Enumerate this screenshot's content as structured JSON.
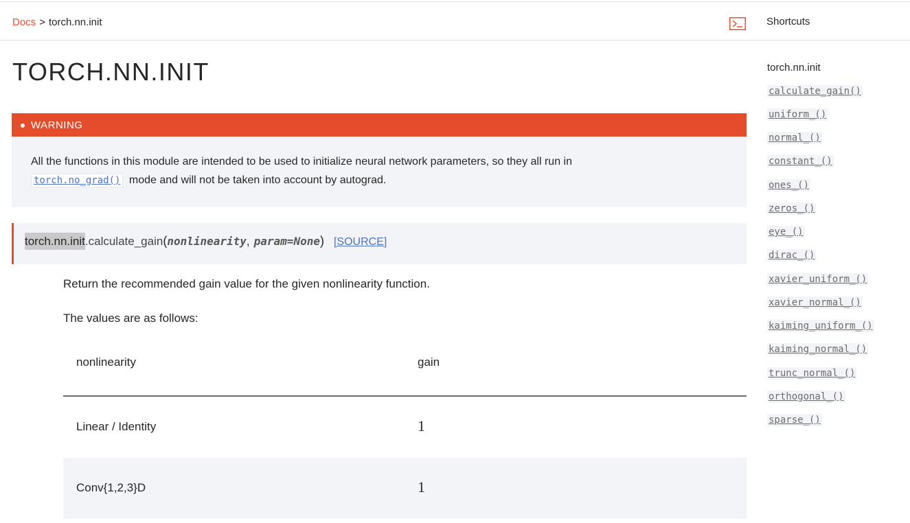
{
  "header": {
    "breadcrumb_link": "Docs",
    "breadcrumb_sep": ">",
    "breadcrumb_current": "torch.nn.init",
    "terminal_icon": "terminal-icon",
    "shortcuts_title": "Shortcuts"
  },
  "main": {
    "title": "TORCH.NN.INIT",
    "warning": {
      "label": "WARNING",
      "text_line1": "All the functions in this module are intended to be used to initialize neural network parameters, so they all run in",
      "code": "torch.no_grad()",
      "text_line2_rest": "mode and will not be taken into account by autograd."
    },
    "signature": {
      "module": "torch.nn.init",
      "function": ".calculate_gain",
      "open_paren": "(",
      "param1": "nonlinearity",
      "comma": ",",
      "param2": "param=None",
      "close_paren": ")",
      "source_link": "[SOURCE]"
    },
    "description": "Return the recommended gain value for the given nonlinearity function.",
    "values_intro": "The values are as follows:",
    "table": {
      "headers": [
        "nonlinearity",
        "gain"
      ],
      "rows": [
        [
          "Linear / Identity",
          "1"
        ],
        [
          "Conv{1,2,3}D",
          "1"
        ]
      ]
    }
  },
  "sidebar": {
    "current": "torch.nn.init",
    "items": [
      "calculate_gain()",
      "uniform_()",
      "normal_()",
      "constant_()",
      "ones_()",
      "zeros_()",
      "eye_()",
      "dirac_()",
      "xavier_uniform_()",
      "xavier_normal_()",
      "kaiming_uniform_()",
      "kaiming_normal_()",
      "trunc_normal_()",
      "orthogonal_()",
      "sparse_()"
    ]
  },
  "colors": {
    "accent": "#ee4c2c",
    "warning_bg": "#e44c2c",
    "link_blue": "#4c72c6",
    "panel_bg": "#f3f4f7"
  }
}
